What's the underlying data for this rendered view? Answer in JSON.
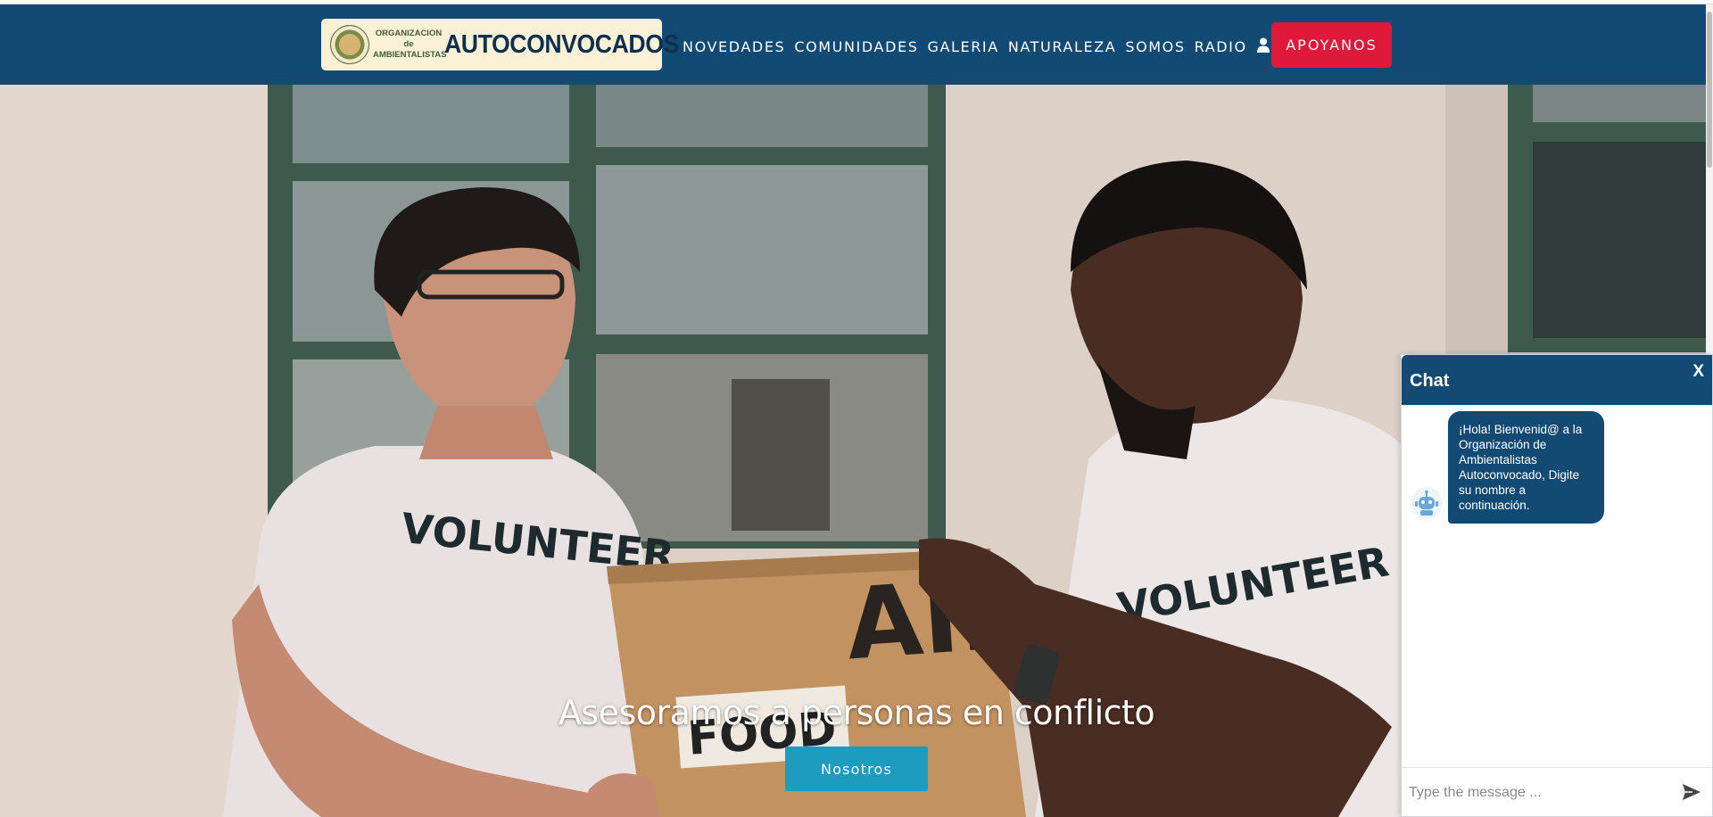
{
  "brand": {
    "small_text_line1": "ORGANIZACION de",
    "small_text_line2": "AMBIENTALISTAS",
    "name": "AUTOCONVOCADOS"
  },
  "nav": {
    "items": [
      "NOVEDADES",
      "COMUNIDADES",
      "GALERIA",
      "NATURALEZA",
      "SOMOS",
      "RADIO"
    ],
    "cta": "APOYANOS"
  },
  "hero": {
    "title": "Asesoramos a personas en conflicto",
    "button": "Nosotros",
    "shirt_text": "VOLUNTEER",
    "box_text_food": "FOOD",
    "box_text_aid": "AID"
  },
  "chat": {
    "title": "Chat",
    "close": "X",
    "bot_message": "¡Hola! Bienvenid@ a la Organización de Ambientalistas Autoconvocado, Digite su nombre a continuación.",
    "input_placeholder": "Type the message ..."
  },
  "colors": {
    "navbar": "#124a74",
    "cta": "#e0183a",
    "hero_button": "#1e9cbf",
    "logo_bg": "#fbf1d6"
  },
  "icons": [
    "user-icon",
    "bot-avatar-icon",
    "send-icon",
    "close-icon"
  ]
}
